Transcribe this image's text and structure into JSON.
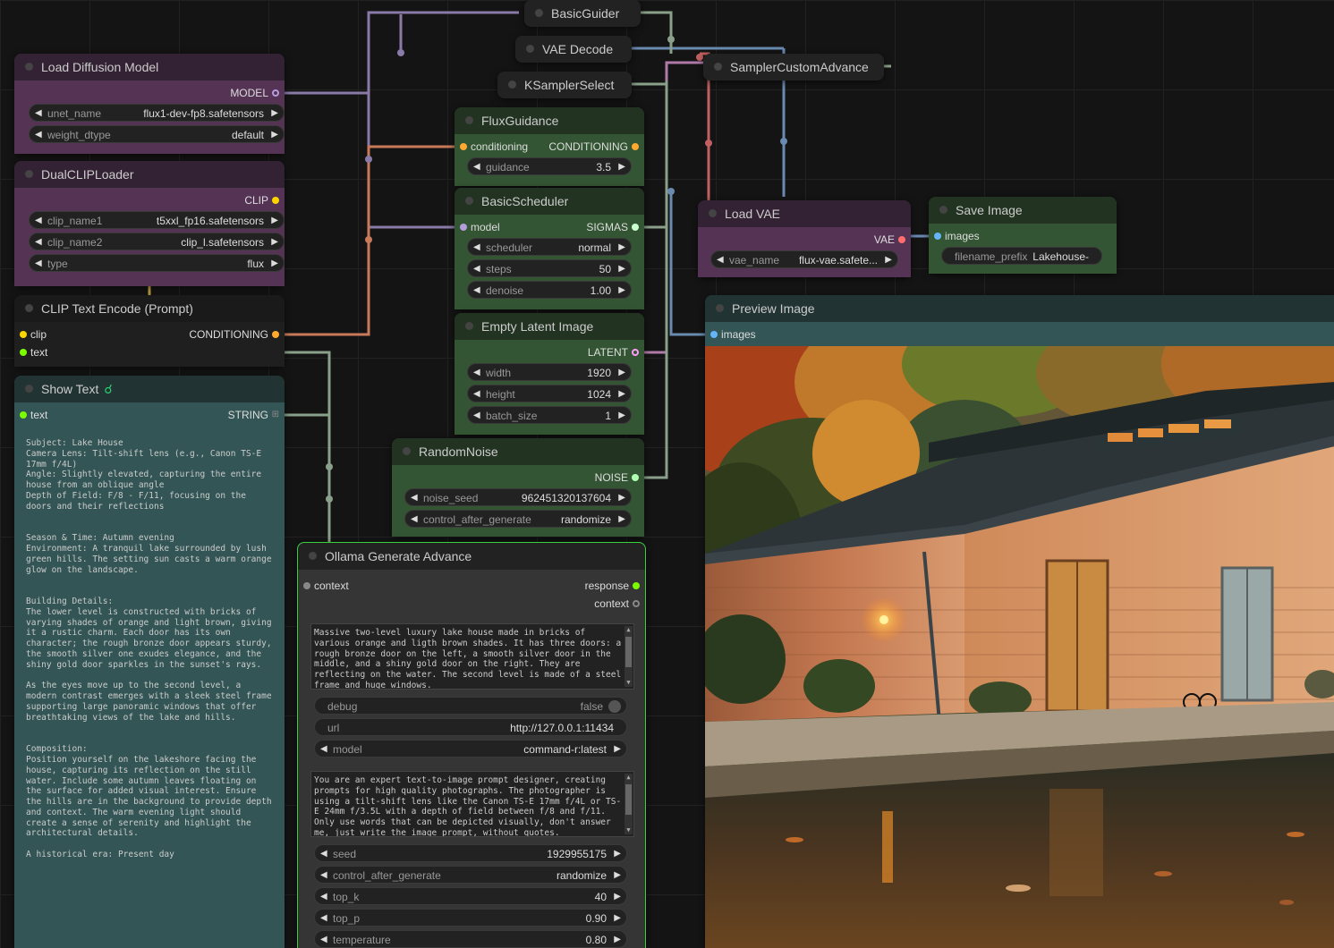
{
  "colors": {
    "model": "#b39ddb",
    "clip": "#ffd500",
    "conditioning": "#ffa931",
    "latent": "#ff9cf9",
    "vae": "#ff6e6e",
    "image": "#64b5f6",
    "string": "#7cfc00",
    "sigmas": "#cdffcd",
    "noise": "#b0b0b0",
    "guider": "#66ffff",
    "sampler": "#ecb4b4"
  },
  "nodes": {
    "basic_guider": {
      "title": "BasicGuider"
    },
    "vae_decode": {
      "title": "VAE Decode"
    },
    "ksampler_select": {
      "title": "KSamplerSelect"
    },
    "sampler_custom_advance": {
      "title": "SamplerCustomAdvance"
    },
    "load_diffusion": {
      "title": "Load Diffusion Model",
      "output": "MODEL",
      "widgets": [
        {
          "label": "unet_name",
          "value": "flux1-dev-fp8.safetensors"
        },
        {
          "label": "weight_dtype",
          "value": "default"
        }
      ]
    },
    "dual_clip": {
      "title": "DualCLIPLoader",
      "output": "CLIP",
      "widgets": [
        {
          "label": "clip_name1",
          "value": "t5xxl_fp16.safetensors"
        },
        {
          "label": "clip_name2",
          "value": "clip_l.safetensors"
        },
        {
          "label": "type",
          "value": "flux"
        }
      ]
    },
    "clip_text": {
      "title": "CLIP Text Encode (Prompt)",
      "input1": "clip",
      "input2": "text",
      "output": "CONDITIONING"
    },
    "show_text": {
      "title": "Show Text",
      "input": "text",
      "output": "STRING",
      "text": "Subject: Lake House\nCamera Lens: Tilt-shift lens (e.g., Canon TS-E 17mm f/4L)\nAngle: Slightly elevated, capturing the entire house from an oblique angle\nDepth of Field: F/8 - F/11, focusing on the doors and their reflections\n\n\nSeason & Time: Autumn evening\nEnvironment: A tranquil lake surrounded by lush green hills. The setting sun casts a warm orange glow on the landscape.\n\n\nBuilding Details:\nThe lower level is constructed with bricks of varying shades of orange and light brown, giving it a rustic charm. Each door has its own character; the rough bronze door appears sturdy, the smooth silver one exudes elegance, and the shiny gold door sparkles in the sunset's rays.\n\nAs the eyes move up to the second level, a modern contrast emerges with a sleek steel frame supporting large panoramic windows that offer breathtaking views of the lake and hills.\n\n\nComposition:\nPosition yourself on the lakeshore facing the house, capturing its reflection on the still water. Include some autumn leaves floating on the surface for added visual interest. Ensure the hills are in the background to provide depth and context. The warm evening light should create a sense of serenity and highlight the architectural details.\n\nA historical era: Present day"
    },
    "flux_guidance": {
      "title": "FluxGuidance",
      "input": "conditioning",
      "output": "CONDITIONING",
      "widgets": [
        {
          "label": "guidance",
          "value": "3.5"
        }
      ]
    },
    "basic_scheduler": {
      "title": "BasicScheduler",
      "input": "model",
      "output": "SIGMAS",
      "widgets": [
        {
          "label": "scheduler",
          "value": "normal"
        },
        {
          "label": "steps",
          "value": "50"
        },
        {
          "label": "denoise",
          "value": "1.00"
        }
      ]
    },
    "empty_latent": {
      "title": "Empty Latent Image",
      "output": "LATENT",
      "widgets": [
        {
          "label": "width",
          "value": "1920"
        },
        {
          "label": "height",
          "value": "1024"
        },
        {
          "label": "batch_size",
          "value": "1"
        }
      ]
    },
    "random_noise": {
      "title": "RandomNoise",
      "output": "NOISE",
      "widgets": [
        {
          "label": "noise_seed",
          "value": "962451320137604"
        },
        {
          "label": "control_after_generate",
          "value": "randomize"
        }
      ]
    },
    "ollama": {
      "title": "Ollama Generate Advance",
      "input": "context",
      "output1": "response",
      "output2": "context",
      "prompt": "Massive two-level luxury lake house made in bricks of various orange and ligth brown shades. It has three doors: a rough bronze door on the left, a smooth silver door in the middle, and a shiny gold door on the right. They are reflecting on the water. The second level is made of a steel frame and huge windows.",
      "debug_label": "debug",
      "debug_value": "false",
      "url_label": "url",
      "url_value": "http://127.0.0.1:11434",
      "model_label": "model",
      "model_value": "command-r:latest",
      "system": "You are an expert text-to-image prompt designer, creating prompts for high quality photographs. The photographer is using a tilt-shift lens like the Canon TS-E 17mm f/4L or TS-E 24mm f/3.5L with a depth of field between f/8 and f/11. Only use words that can be depicted visually, don't answer me, just write the image prompt, without quotes.",
      "widgets": [
        {
          "label": "seed",
          "value": "1929955175"
        },
        {
          "label": "control_after_generate",
          "value": "randomize"
        },
        {
          "label": "top_k",
          "value": "40"
        },
        {
          "label": "top_p",
          "value": "0.90"
        },
        {
          "label": "temperature",
          "value": "0.80"
        }
      ]
    },
    "load_vae": {
      "title": "Load VAE",
      "output": "VAE",
      "widgets": [
        {
          "label": "vae_name",
          "value": "flux-vae.safete..."
        }
      ]
    },
    "save_image": {
      "title": "Save Image",
      "input": "images",
      "widgets": [
        {
          "label": "filename_prefix",
          "value": "Lakehouse-"
        }
      ]
    },
    "preview_image": {
      "title": "Preview Image",
      "input": "images"
    }
  }
}
